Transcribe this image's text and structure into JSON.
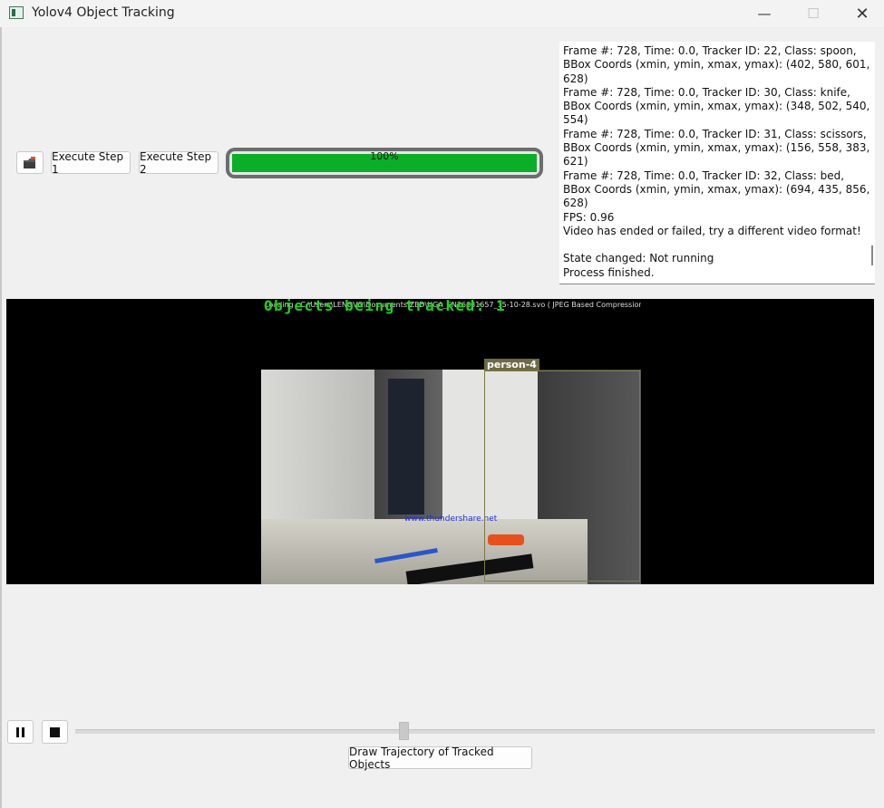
{
  "window": {
    "title": "Yolov4 Object Tracking",
    "minimize": "—",
    "maximize": "☐",
    "close": "✕"
  },
  "toolbar": {
    "open_icon": "folder-open-icon",
    "step1_label": "Execute Step 1",
    "step2_label": "Execute Step 2",
    "progress_text": "100%",
    "progress_value": 1.0,
    "progress_color": "#0aae28"
  },
  "log": {
    "lines": [
      "Frame #: 728, Time: 0.0, Tracker ID: 22, Class: spoon, BBox Coords (xmin, ymin, xmax, ymax): (402, 580, 601, 628)",
      "Frame #: 728, Time: 0.0, Tracker ID: 30, Class: knife, BBox Coords (xmin, ymin, xmax, ymax): (348, 502, 540, 554)",
      "Frame #: 728, Time: 0.0, Tracker ID: 31, Class: scissors, BBox Coords (xmin, ymin, xmax, ymax): (156, 558, 383, 621)",
      "Frame #: 728, Time: 0.0, Tracker ID: 32, Class: bed,  BBox Coords (xmin, ymin, xmax, ymax): (694, 435, 856, 628)",
      "FPS: 0.96",
      "Video has ended or failed, try a different video format!",
      "",
      "State changed: Not running",
      "Process finished."
    ]
  },
  "video": {
    "overlay_text": "Objects being tracked: 1",
    "path_text": "Loading : C:\\Users\\LENOVO\\Documents\\ZED\\HGA_SN26631657_15-10-28.svo ( JPEG Based Compression )",
    "bbox_label": "person-4",
    "watermark": "www.thundershare.net"
  },
  "controls": {
    "pause_icon": "pause-icon",
    "stop_icon": "stop-icon",
    "slider_value": 0.41,
    "draw_trajectory_label": "Draw Trajectory of Tracked Objects"
  }
}
